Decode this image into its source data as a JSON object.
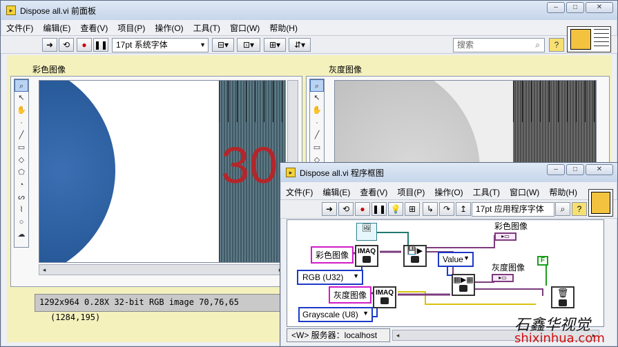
{
  "front_panel": {
    "title": "Dispose all.vi 前面板",
    "menu": [
      "文件(F)",
      "编辑(E)",
      "查看(V)",
      "项目(P)",
      "操作(O)",
      "工具(T)",
      "窗口(W)",
      "帮助(H)"
    ],
    "font": "17pt 系统字体",
    "search_placeholder": "搜索",
    "color_image_label": "彩色图像",
    "gray_image_label": "灰度图像",
    "ruler_number": "30",
    "status_text": "1292x964 0.28X 32-bit RGB image 70,76,65",
    "status_coords": "(1284,195)"
  },
  "block_diagram": {
    "title": "Dispose all.vi 程序框图",
    "menu": [
      "文件(F)",
      "编辑(E)",
      "查看(V)",
      "项目(P)",
      "操作(O)",
      "工具(T)",
      "窗口(W)",
      "帮助(H)"
    ],
    "font": "17pt 应用程序字体",
    "nodes": {
      "color_const": "彩色图像",
      "gray_const": "灰度图像",
      "imaq1": "IMAQ",
      "imaq2": "IMAQ",
      "rgb_type": "RGB (U32)",
      "gray_type": "Grayscale (U8)",
      "value": "Value",
      "color_indicator": "彩色图像",
      "gray_indicator": "灰度图像",
      "false_const": "F"
    },
    "status_text": "<W> 服务器：localhost"
  },
  "watermark": {
    "brand": "石鑫华视觉",
    "url": "shixinhua.com"
  },
  "colors": {
    "panel_bg": "#f4f1bd",
    "imaq_wire": "#7b3b7c",
    "value_box": "#1b39c7"
  }
}
